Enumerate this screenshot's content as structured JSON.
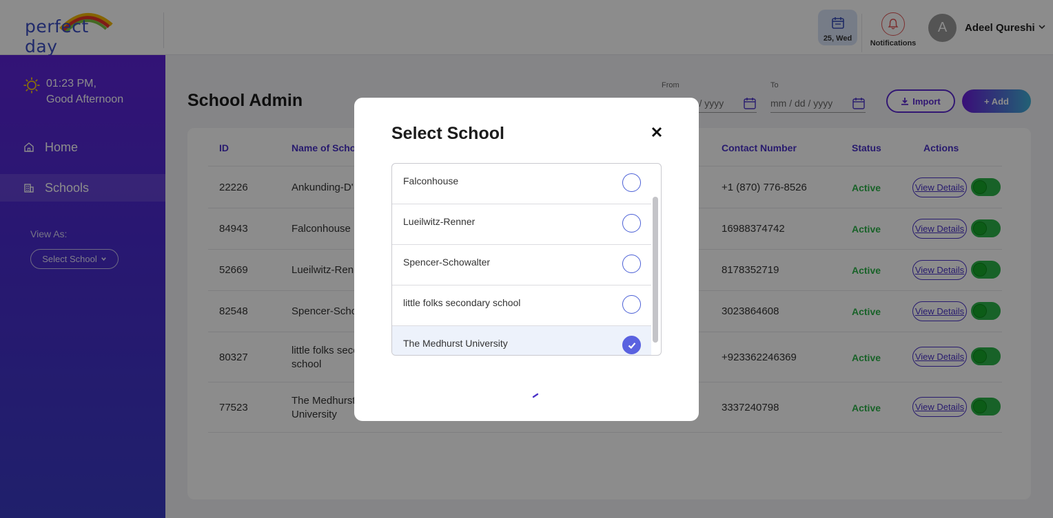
{
  "header": {
    "logo_text": "perfect day",
    "date_chip": "25, Wed",
    "notifications_label": "Notifications",
    "avatar_initial": "A",
    "user_name": "Adeel Qureshi"
  },
  "sidebar": {
    "time": "01:23 PM,",
    "greeting": "Good Afternoon",
    "nav": [
      {
        "label": "Home",
        "icon": "home-icon"
      },
      {
        "label": "Schools",
        "icon": "building-icon",
        "active": true
      }
    ],
    "view_as_label": "View As:",
    "select_school_label": "Select School"
  },
  "main": {
    "title": "School Admin",
    "filters": {
      "from_label": "From",
      "to_label": "To",
      "from_placeholder": "mm / dd / yyyy",
      "to_placeholder": "mm / dd / yyyy"
    },
    "import_label": "Import",
    "add_label": "+ Add",
    "table": {
      "headers": [
        "ID",
        "Name of School",
        "Contact Number",
        "Status",
        "Actions"
      ],
      "rows": [
        {
          "id": "22226",
          "name": "Ankunding-D'",
          "contact": "+1 (870) 776-8526",
          "status": "Active"
        },
        {
          "id": "84943",
          "name": "Falconhouse",
          "contact": "16988374742",
          "status": "Active"
        },
        {
          "id": "52669",
          "name": "Lueilwitz-Renr",
          "contact": "8178352719",
          "status": "Active"
        },
        {
          "id": "82548",
          "name": "Spencer-Schov",
          "contact": "3023864608",
          "status": "Active"
        },
        {
          "id": "80327",
          "name": "little folks seco",
          "name2": "school",
          "contact": "+923362246369",
          "status": "Active"
        },
        {
          "id": "77523",
          "name": "The Medhurst",
          "name2": "University",
          "contact": "3337240798",
          "status": "Active"
        }
      ],
      "view_details_label": "View Details"
    }
  },
  "modal": {
    "title": "Select School",
    "schools": [
      {
        "name": "Falconhouse",
        "selected": false
      },
      {
        "name": "Lueilwitz-Renner",
        "selected": false
      },
      {
        "name": "Spencer-Schowalter",
        "selected": false
      },
      {
        "name": "little folks secondary school",
        "selected": false
      },
      {
        "name": "The Medhurst University",
        "selected": true
      }
    ]
  },
  "colors": {
    "accent": "#4a32c8",
    "sidebar_top": "#5d24d8",
    "active_status": "#2db34a",
    "selected_radio": "#5a62e0"
  }
}
